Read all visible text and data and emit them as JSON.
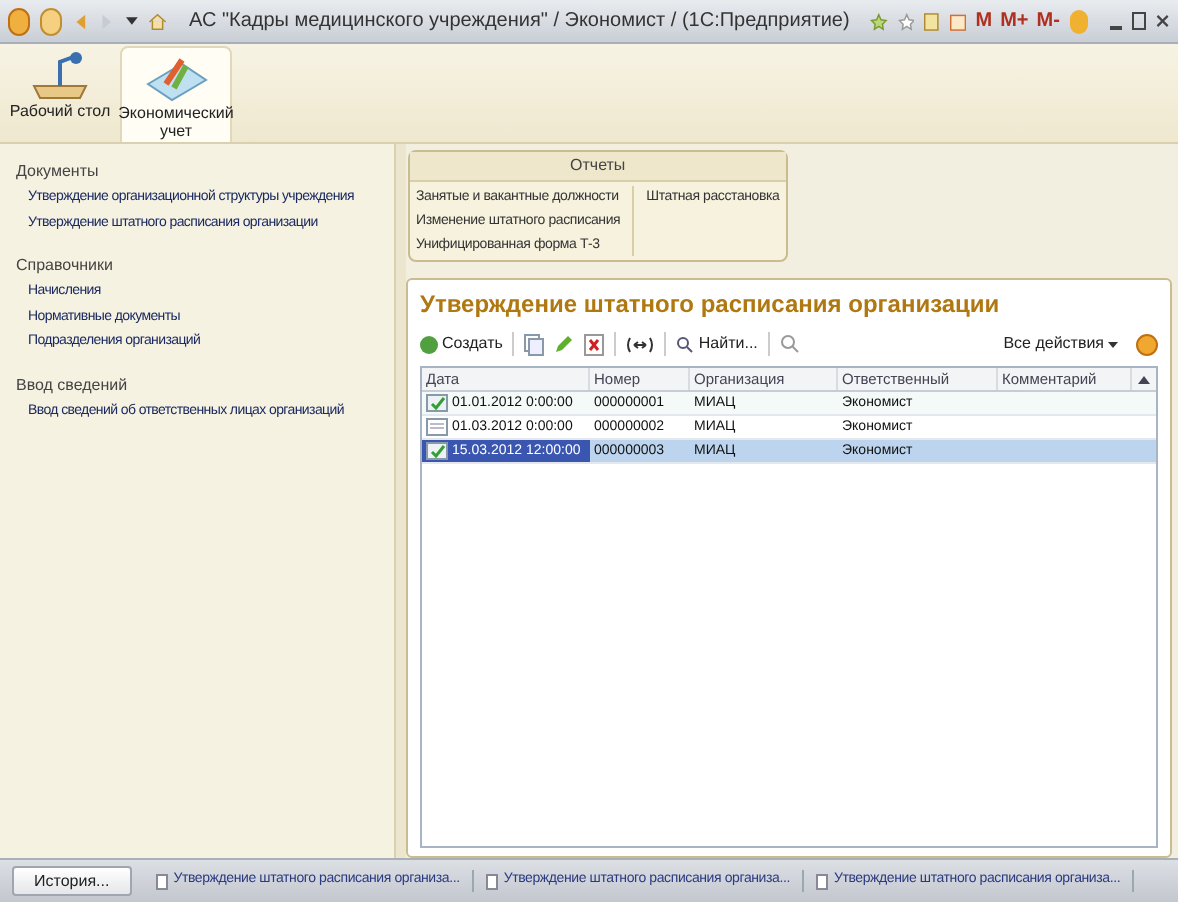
{
  "window": {
    "title": "АС \"Кадры медицинского учреждения\" / Экономист /  (1С:Предприятие)",
    "memory_buttons": [
      "M",
      "M+",
      "M-"
    ]
  },
  "sections": [
    {
      "label": "Рабочий стол",
      "selected": false
    },
    {
      "label": "Экономический учет",
      "selected": true
    }
  ],
  "navigation": [
    {
      "heading": "Документы",
      "items": [
        "Утверждение организационной структуры учреждения",
        "Утверждение штатного расписания организации"
      ]
    },
    {
      "heading": "Справочники",
      "items": [
        "Начисления",
        "Нормативные документы",
        "Подразделения организаций"
      ]
    },
    {
      "heading": "Ввод сведений",
      "items": [
        "Ввод сведений об ответственных лицах организаций"
      ]
    }
  ],
  "reports": {
    "title": "Отчеты",
    "column_1": [
      "Занятые и вакантные должности",
      "Изменение штатного расписания",
      "Унифицированная форма Т-3"
    ],
    "column_2": [
      "Штатная расстановка"
    ]
  },
  "form": {
    "title": "Утверждение штатного расписания организации",
    "create_button": "Создать",
    "find_button": "Найти...",
    "all_actions": "Все действия",
    "table": {
      "columns": [
        "Дата",
        "Номер",
        "Организация",
        "Ответственный",
        "Комментарий"
      ],
      "rows": [
        {
          "posted": true,
          "selected": false,
          "cells": [
            "01.01.2012 0:00:00",
            "000000001",
            "МИАЦ",
            "Экономист"
          ]
        },
        {
          "posted": false,
          "selected": false,
          "cells": [
            "01.03.2012 0:00:00",
            "000000002",
            "МИАЦ",
            "Экономист"
          ]
        },
        {
          "posted": true,
          "selected": true,
          "cells": [
            "15.03.2012 12:00:00",
            "000000003",
            "МИАЦ",
            "Экономист"
          ]
        }
      ]
    }
  },
  "status_bar": {
    "history_button": "История...",
    "open_windows": [
      "Утверждение штатного расписания организа...",
      "Утверждение штатного расписания организа...",
      "Утверждение штатного расписания организа..."
    ]
  }
}
